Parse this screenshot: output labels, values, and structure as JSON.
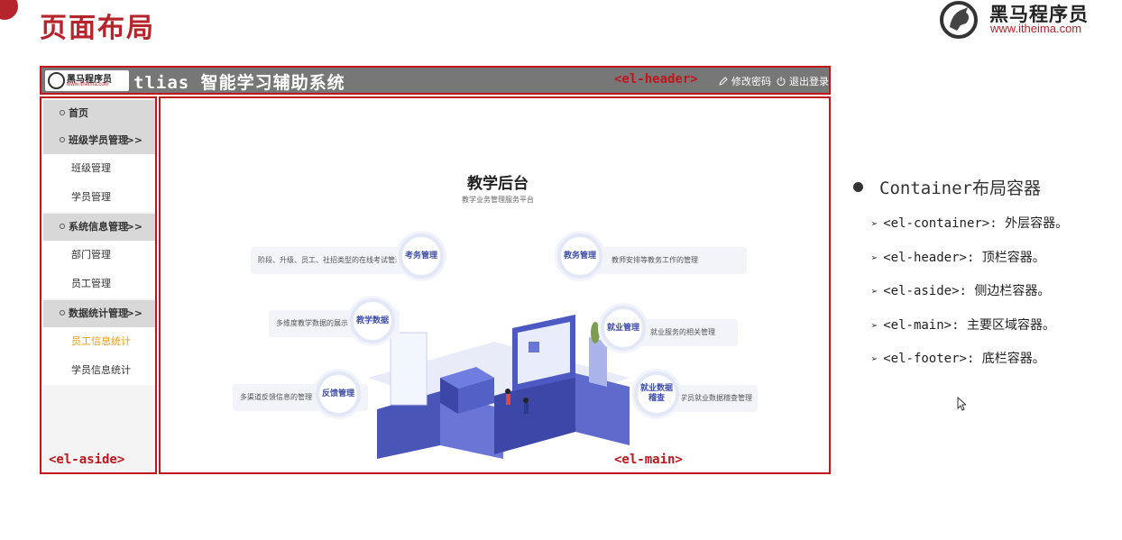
{
  "slide": {
    "title": "页面布局",
    "brand_name": "黑马程序员",
    "brand_url": "www.itheima.com"
  },
  "app": {
    "header": {
      "logo_name": "黑马程序员",
      "logo_url": "www.itheima.com",
      "title": "tlias 智能学习辅助系统",
      "tag": "<el-header>",
      "change_password": "修改密码",
      "logout": "退出登录"
    },
    "aside": {
      "tag": "<el-aside>",
      "home": "首页",
      "groups": [
        {
          "label": "班级学员管理",
          "arrow": ">>",
          "items": [
            "班级管理",
            "学员管理"
          ]
        },
        {
          "label": "系统信息管理",
          "arrow": ">>",
          "items": [
            "部门管理",
            "员工管理"
          ]
        },
        {
          "label": "数据统计管理",
          "arrow": ">>",
          "items": [
            "员工信息统计",
            "学员信息统计"
          ]
        }
      ],
      "active_item": "员工信息统计"
    },
    "main": {
      "tag": "<el-main>",
      "hero_title": "教学后台",
      "hero_subtitle": "教学业务管理服务平台",
      "features": [
        {
          "bubble": "考务管理",
          "desc": "阶段、升级、员工、社招类型的在线考试管理"
        },
        {
          "bubble": "教学数据",
          "desc": "多维度教学数据的展示"
        },
        {
          "bubble": "反馈管理",
          "desc": "多渠道反馈信息的管理"
        },
        {
          "bubble": "教务管理",
          "desc": "教师安排等教务工作的管理"
        },
        {
          "bubble": "就业管理",
          "desc": "就业服务的相关管理"
        },
        {
          "bubble": "就业数据稽查",
          "desc": "学员就业数据稽查管理"
        }
      ]
    }
  },
  "notes": {
    "heading": "Container布局容器",
    "items": [
      "<el-container>: 外层容器。",
      "<el-header>: 顶栏容器。",
      "<el-aside>: 侧边栏容器。",
      "<el-main>: 主要区域容器。",
      "<el-footer>: 底栏容器。"
    ]
  },
  "colors": {
    "accent_red": "#c0161c",
    "title_red": "#b5252b",
    "header_gray": "#777777",
    "active_menu": "#f39c12",
    "feature_blue": "#3f4ea8"
  }
}
